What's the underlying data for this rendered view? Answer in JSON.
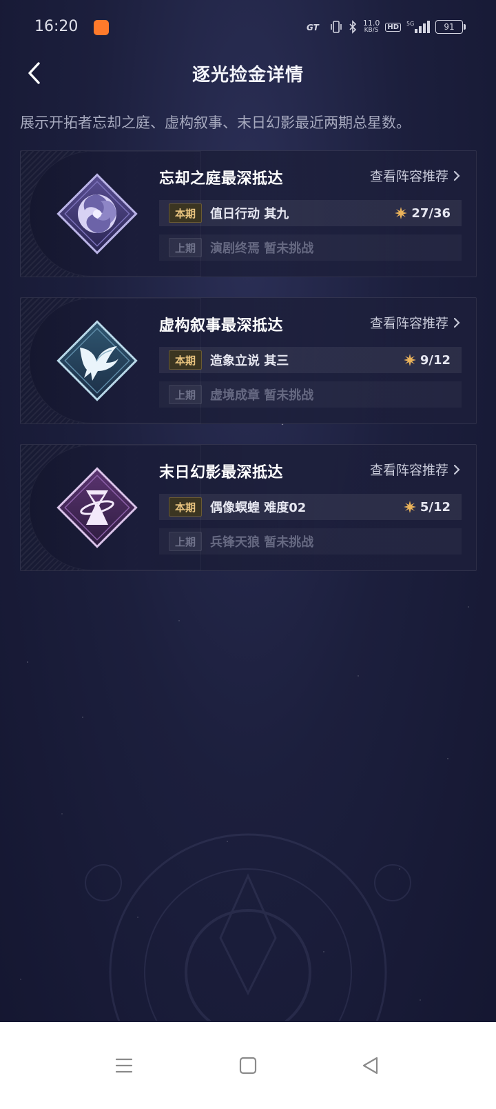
{
  "status_bar": {
    "time": "16:20",
    "net_speed": "11.0",
    "net_unit": "KB/S",
    "hd": "HD",
    "signal": "5G",
    "battery": "91"
  },
  "header": {
    "title": "逐光捡金详情",
    "back_icon": "chevron-left-icon"
  },
  "description": "展示开拓者忘却之庭、虚构叙事、末日幻影最近两期总星数。",
  "cards": [
    {
      "title": "忘却之庭最深抵达",
      "icon": "swirl-icon",
      "lineup_label": "查看阵容推荐",
      "current": {
        "tag": "本期",
        "name": "值日行动 其九",
        "stars": "27/36"
      },
      "previous": {
        "tag": "上期",
        "name": "演剧终焉 暂未挑战"
      }
    },
    {
      "title": "虚构叙事最深抵达",
      "icon": "dove-icon",
      "lineup_label": "查看阵容推荐",
      "current": {
        "tag": "本期",
        "name": "造象立说 其三",
        "stars": "9/12"
      },
      "previous": {
        "tag": "上期",
        "name": "虚境成章 暂未挑战"
      }
    },
    {
      "title": "末日幻影最深抵达",
      "icon": "hourglass-icon",
      "lineup_label": "查看阵容推荐",
      "current": {
        "tag": "本期",
        "name": "偶像螟蝗 难度02",
        "stars": "5/12"
      },
      "previous": {
        "tag": "上期",
        "name": "兵锋天狼 暂未挑战"
      }
    }
  ],
  "colors": {
    "background": "#1c1f3d",
    "star_accent": "#e9b25a",
    "current_tag": "#e9c47f"
  }
}
